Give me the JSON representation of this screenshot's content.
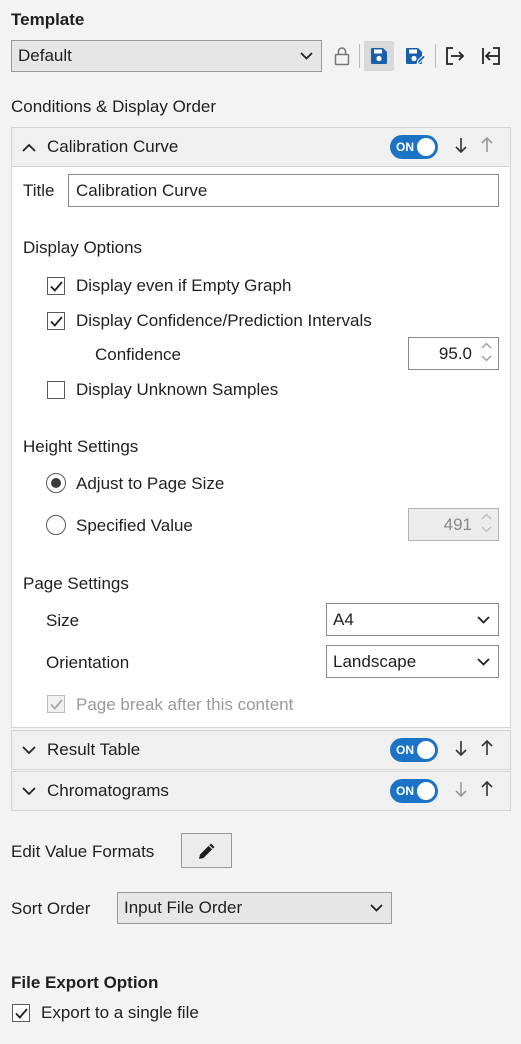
{
  "template": {
    "heading": "Template",
    "selected": "Default",
    "icons": [
      "lock-icon",
      "save-icon",
      "save-as-icon",
      "export-icon",
      "import-icon"
    ]
  },
  "conditions": {
    "heading": "Conditions & Display Order"
  },
  "calibration": {
    "label": "Calibration Curve",
    "toggle": "ON",
    "title_label": "Title",
    "title_value": "Calibration Curve",
    "display_options": {
      "heading": "Display Options",
      "empty_graph": {
        "label": "Display even if Empty Graph",
        "checked": true
      },
      "intervals": {
        "label": "Display Confidence/Prediction Intervals",
        "checked": true
      },
      "confidence_label": "Confidence",
      "confidence_value": "95.0",
      "unknown": {
        "label": "Display Unknown Samples",
        "checked": false
      }
    },
    "height": {
      "heading": "Height Settings",
      "adjust_label": "Adjust to Page Size",
      "specified_label": "Specified Value",
      "specified_value": "491",
      "selected": "adjust"
    },
    "page": {
      "heading": "Page Settings",
      "size_label": "Size",
      "size_value": "A4",
      "orientation_label": "Orientation",
      "orientation_value": "Landscape",
      "page_break_label": "Page break after this content",
      "page_break_checked": true
    }
  },
  "result_table": {
    "label": "Result Table",
    "toggle": "ON"
  },
  "chromatograms": {
    "label": "Chromatograms",
    "toggle": "ON"
  },
  "edit_formats": {
    "label": "Edit Value Formats"
  },
  "sort_order": {
    "label": "Sort Order",
    "value": "Input File Order"
  },
  "file_export": {
    "heading": "File Export Option",
    "single_file": {
      "label": "Export to a single file",
      "checked": true
    }
  },
  "colors": {
    "accent": "#1a73c4",
    "icon_blue": "#1b5fa8"
  }
}
